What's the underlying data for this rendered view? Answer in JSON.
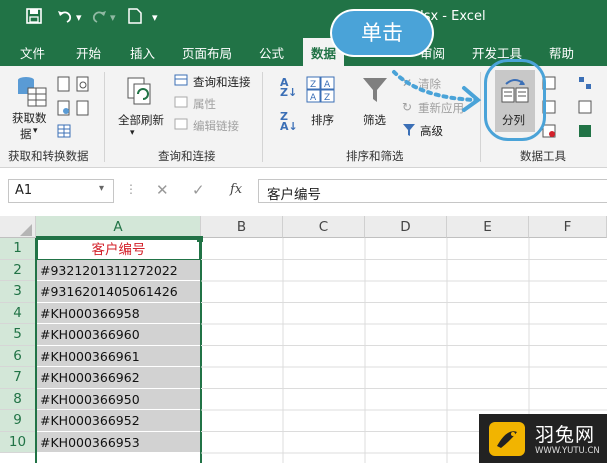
{
  "window": {
    "title": "6.xlsx  -  Excel"
  },
  "quick_access": {
    "save_icon": "save-icon",
    "undo_icon": "undo-icon",
    "redo_icon": "redo-icon",
    "new_icon": "new-doc-icon",
    "customize_icon": "chevron-down-icon"
  },
  "tabs": [
    {
      "label": "文件"
    },
    {
      "label": "开始"
    },
    {
      "label": "插入"
    },
    {
      "label": "页面布局"
    },
    {
      "label": "公式"
    },
    {
      "label": "数据"
    },
    {
      "label": "审阅"
    },
    {
      "label": "开发工具"
    },
    {
      "label": "帮助"
    }
  ],
  "ribbon": {
    "get_data": {
      "label": "获取数",
      "label2": "据",
      "group": "获取和转换数据"
    },
    "query": {
      "refresh_all": "全部刷新",
      "query_connect": "查询和连接",
      "properties": "属性",
      "edit_links": "编辑链接",
      "group": "查询和连接"
    },
    "sort": {
      "sort_label": "排序",
      "filter_label": "筛选",
      "clear": "清除",
      "reapply": "重新应用",
      "advanced": "高级",
      "group": "排序和筛选"
    },
    "tools": {
      "text_to_columns": "分列",
      "group": "数据工具"
    }
  },
  "formula_bar": {
    "name_box": "A1",
    "fx": "fx",
    "content": "客户编号"
  },
  "grid": {
    "columns": [
      "A",
      "B",
      "C",
      "D",
      "E",
      "F"
    ],
    "rows": [
      {
        "n": "1",
        "a": "客户编号"
      },
      {
        "n": "2",
        "a": "#9321201311272022"
      },
      {
        "n": "3",
        "a": "#9316201405061426"
      },
      {
        "n": "4",
        "a": "#KH000366958"
      },
      {
        "n": "5",
        "a": "#KH000366960"
      },
      {
        "n": "6",
        "a": "#KH000366961"
      },
      {
        "n": "7",
        "a": "#KH000366962"
      },
      {
        "n": "8",
        "a": "#KH000366950"
      },
      {
        "n": "9",
        "a": "#KH000366952"
      },
      {
        "n": "10",
        "a": "#KH000366953"
      }
    ]
  },
  "callout": {
    "label": "单击"
  },
  "watermark": {
    "name": "羽兔网",
    "url": "WWW.YUTU.CN"
  },
  "colors": {
    "excel_green": "#217346",
    "callout_blue": "#4aa3d8",
    "header_red": "#d3202a",
    "selection_gray": "#d2d2d2"
  }
}
